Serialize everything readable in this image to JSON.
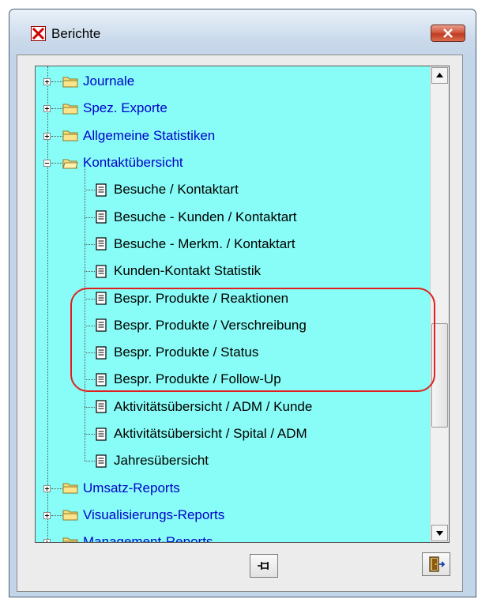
{
  "window": {
    "title": "Berichte",
    "icons": {
      "app": "red-x-icon",
      "close": "close-icon"
    }
  },
  "tree": {
    "items": [
      {
        "label": "Journale",
        "type": "folder",
        "expander": "plus"
      },
      {
        "label": "Spez. Exporte",
        "type": "folder",
        "expander": "plus"
      },
      {
        "label": "Allgemeine Statistiken",
        "type": "folder",
        "expander": "plus"
      },
      {
        "label": "Kontaktübersicht",
        "type": "folder",
        "expander": "minus",
        "open": true
      },
      {
        "label": "Besuche / Kontaktart",
        "type": "report"
      },
      {
        "label": "Besuche - Kunden / Kontaktart",
        "type": "report"
      },
      {
        "label": "Besuche - Merkm. / Kontaktart",
        "type": "report"
      },
      {
        "label": "Kunden-Kontakt Statistik",
        "type": "report"
      },
      {
        "label": "Bespr. Produkte / Reaktionen",
        "type": "report",
        "highlighted": true
      },
      {
        "label": "Bespr. Produkte / Verschreibung",
        "type": "report",
        "highlighted": true
      },
      {
        "label": "Bespr. Produkte / Status",
        "type": "report",
        "highlighted": true
      },
      {
        "label": "Bespr. Produkte / Follow-Up",
        "type": "report",
        "highlighted": true
      },
      {
        "label": "Aktivitätsübersicht / ADM / Kunde",
        "type": "report"
      },
      {
        "label": "Aktivitätsübersicht / Spital / ADM",
        "type": "report"
      },
      {
        "label": "Jahresübersicht",
        "type": "report"
      },
      {
        "label": "Umsatz-Reports",
        "type": "folder",
        "expander": "plus"
      },
      {
        "label": "Visualisierungs-Reports",
        "type": "folder",
        "expander": "plus"
      },
      {
        "label": "Management-Reports",
        "type": "folder",
        "expander": "plus"
      }
    ]
  },
  "toolbar": {
    "pin_icon": "pin-icon",
    "exit_icon": "exit-door-icon"
  },
  "colors": {
    "tree_background": "#88fcf6",
    "folder_text": "#0000cc",
    "highlight_outline": "#e02020"
  }
}
